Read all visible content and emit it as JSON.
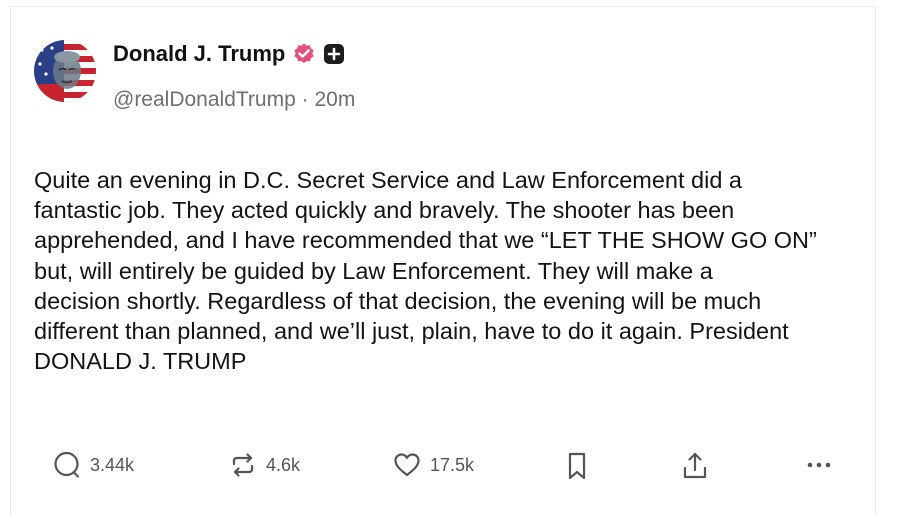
{
  "post": {
    "author": {
      "display_name": "Donald J. Trump",
      "handle": "@realDonaldTrump",
      "time_separator": "·",
      "timestamp": "20m",
      "verified_icon": "verified-badge-icon",
      "extra_badge_icon": "plus-badge-icon"
    },
    "body": "Quite an evening in D.C. Secret Service and Law Enforcement did a\nfantastic job. They acted quickly and bravely. The shooter has been\napprehended, and I have recommended that we “LET THE SHOW GO ON”\nbut, will entirely be guided by Law Enforcement. They will make a\ndecision shortly. Regardless of that decision, the evening will be much\ndifferent than planned, and we’ll just, plain, have to do it again. President\nDONALD J. TRUMP",
    "actions": {
      "replies": {
        "icon": "reply-icon",
        "count": "3.44k"
      },
      "retruths": {
        "icon": "repost-icon",
        "count": "4.6k"
      },
      "likes": {
        "icon": "heart-icon",
        "count": "17.5k"
      },
      "bookmark": {
        "icon": "bookmark-icon"
      },
      "share": {
        "icon": "share-icon"
      },
      "more": {
        "icon": "more-icon"
      }
    }
  },
  "colors": {
    "verified_badge": "#e4507d",
    "plus_badge": "#1c1c1e",
    "text_primary": "#111111",
    "text_secondary": "#6e6e73",
    "action_icons": "#555559",
    "border": "#e7e7ea"
  }
}
